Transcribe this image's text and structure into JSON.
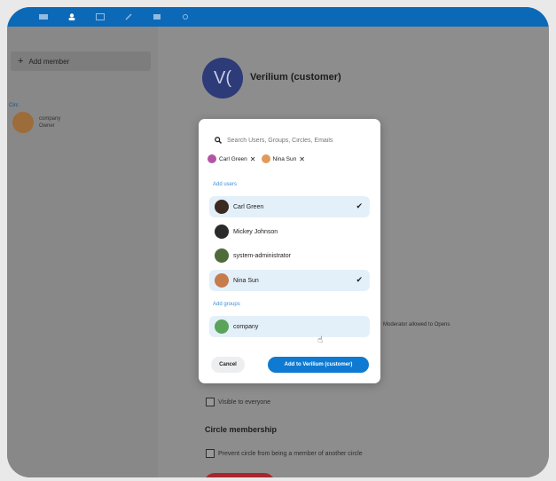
{
  "nav": {
    "icons": [
      "dashboard-icon",
      "contacts-icon",
      "calendar-icon",
      "pen-icon",
      "files-icon",
      "more-icon"
    ],
    "active_index": 1
  },
  "sidebar": {
    "add_member_label": "Add member",
    "member": {
      "name": "company",
      "role": "Owner"
    },
    "section_tag": "Circ"
  },
  "main": {
    "circle_initials": "V(",
    "circle_title": "Verilium (customer)",
    "side_text": "Moderator allowed to Opens",
    "visible_to_everyone": "Visible to everyone",
    "membership_heading": "Circle membership",
    "prevent_member": "Prevent circle from being a member of another circle"
  },
  "modal": {
    "search_placeholder": "Search Users, Groups, Circles, Emails",
    "chips": [
      {
        "name": "Carl Green",
        "color": "#b455a3"
      },
      {
        "name": "Nina Sun",
        "color": "#e29a5b"
      }
    ],
    "add_users_label": "Add users",
    "users": [
      {
        "name": "Carl Green",
        "selected": true,
        "color": "#3a2a1f"
      },
      {
        "name": "Mickey Johnson",
        "selected": false,
        "color": "#2b2b2b"
      },
      {
        "name": "system-administrator",
        "selected": false,
        "color": "#4f6b3a"
      },
      {
        "name": "Nina Sun",
        "selected": true,
        "color": "#c67c4c"
      }
    ],
    "add_groups_label": "Add groups",
    "groups": [
      {
        "name": "company",
        "color": "#5aa35a"
      }
    ],
    "cancel_label": "Cancel",
    "add_label": "Add to Verilium (customer)"
  },
  "colors": {
    "accent": "#0f7ad1",
    "topbar": "#0c69b8",
    "selected_row": "#e4f0f9"
  }
}
